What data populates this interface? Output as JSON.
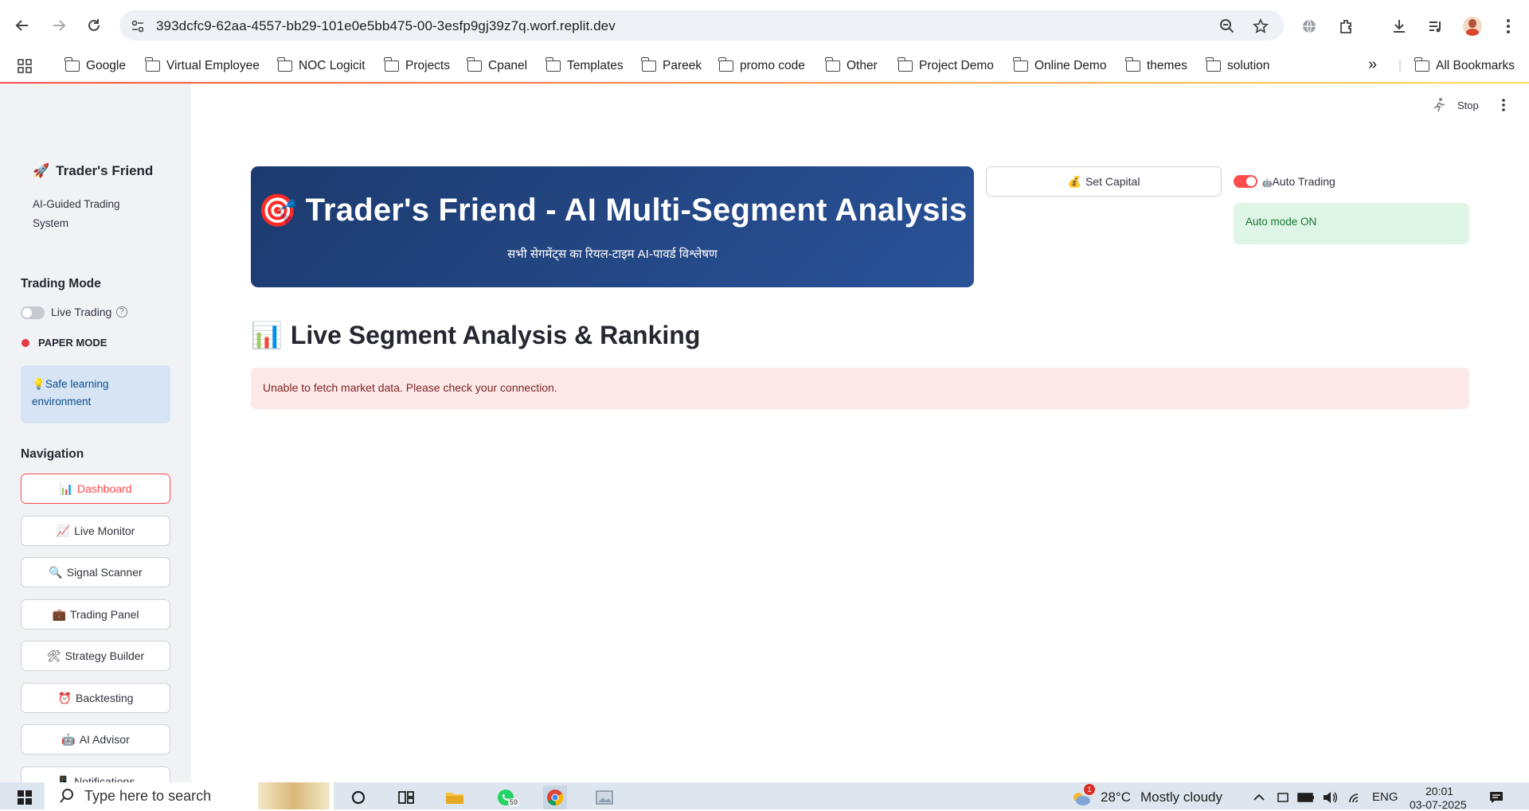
{
  "browser": {
    "url": "393dcfc9-62aa-4557-bb29-101e0e5bb475-00-3esfp9gj39z7q.worf.replit.dev",
    "bookmarks": [
      "Google",
      "Virtual Employee",
      "NOC Logicit",
      "Projects",
      "Cpanel",
      "Templates",
      "Pareek",
      "promo code",
      "Other",
      "Project Demo",
      "Online Demo",
      "themes",
      "solution"
    ],
    "all_bookmarks": "All Bookmarks",
    "more_label": "»"
  },
  "app": {
    "stop_label": "Stop"
  },
  "sidebar": {
    "brand": "Trader's Friend",
    "brand_icon": "🚀",
    "tagline": "AI-Guided Trading System",
    "trading_mode_title": "Trading Mode",
    "live_trading_label": "Live Trading",
    "live_trading_on": false,
    "help_glyph": "?",
    "paper_mode_label": "PAPER MODE",
    "info_icon": "💡",
    "info_text": "Safe learning environment",
    "navigation_title": "Navigation",
    "nav_items": [
      {
        "icon": "📊",
        "label": "Dashboard",
        "active": true
      },
      {
        "icon": "📈",
        "label": "Live Monitor",
        "active": false
      },
      {
        "icon": "🔍",
        "label": "Signal Scanner",
        "active": false
      },
      {
        "icon": "💼",
        "label": "Trading Panel",
        "active": false
      },
      {
        "icon": "🛠",
        "label": "Strategy Builder",
        "active": false
      },
      {
        "icon": "⏰",
        "label": "Backtesting",
        "active": false
      },
      {
        "icon": "🤖",
        "label": "AI Advisor",
        "active": false
      },
      {
        "icon": "📱",
        "label": "Notifications",
        "active": false
      }
    ]
  },
  "main": {
    "hero_icon": "🎯",
    "hero_title": "Trader's Friend - AI Multi-Segment Analysis",
    "hero_subtitle": "सभी सेगमेंट्स का रियल-टाइम AI-पावर्ड विश्लेषण",
    "set_capital_icon": "💰",
    "set_capital_label": "Set Capital",
    "auto_trading_icon": "🤖",
    "auto_trading_label": "Auto Trading",
    "auto_trading_on": true,
    "auto_mode_status": "Auto mode ON",
    "section_icon": "📊",
    "section_title": "Live Segment Analysis & Ranking",
    "error_message": "Unable to fetch market data. Please check your connection."
  },
  "taskbar": {
    "search_placeholder": "Type here to search",
    "whatsapp_badge": "59",
    "weather_badge": "1",
    "temperature": "28°C",
    "weather": "Mostly cloudy",
    "language": "ENG",
    "time": "20:01",
    "date": "03-07-2025"
  },
  "colors": {
    "accent": "#ff4b4b",
    "hero_start": "#1c3a6e",
    "hero_end": "#2a5298",
    "sidebar_bg": "#f0f2f6",
    "success_bg": "#dff5e6",
    "error_bg": "#fde8e8",
    "info_bg": "#d6e4f4"
  }
}
